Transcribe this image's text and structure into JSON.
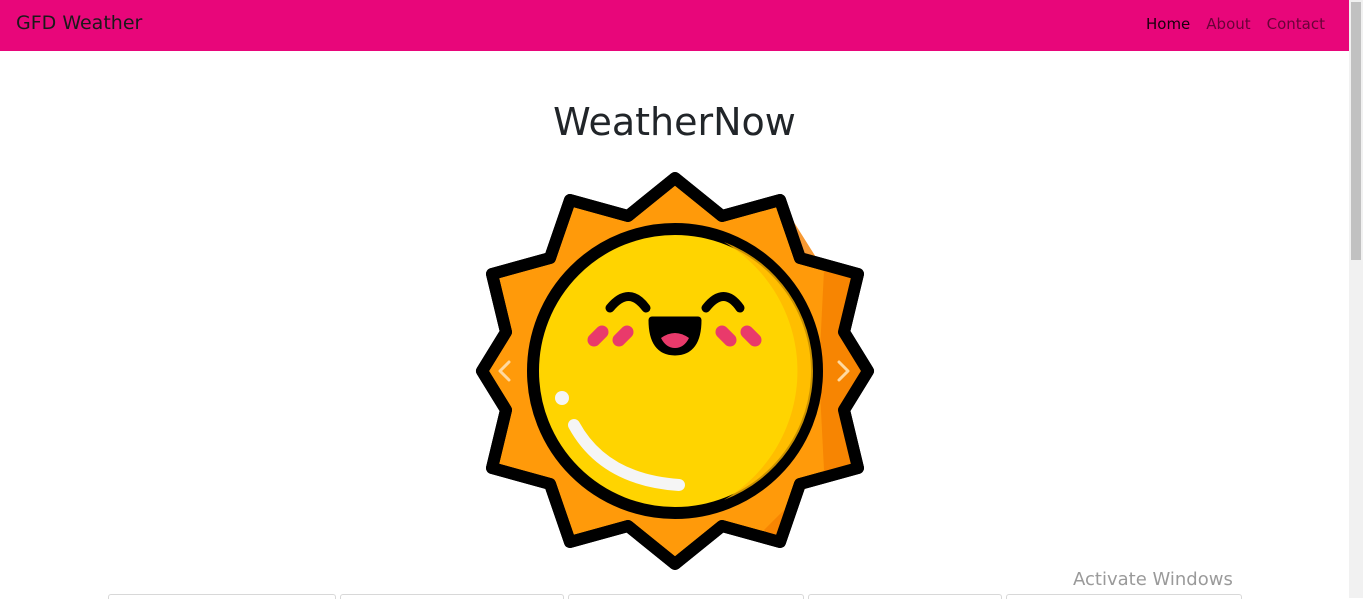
{
  "navbar": {
    "brand": "GFD Weather",
    "links": [
      {
        "label": "Home",
        "active": true
      },
      {
        "label": "About",
        "active": false
      },
      {
        "label": "Contact",
        "active": false
      }
    ],
    "background": "#e8067a"
  },
  "main": {
    "title": "WeatherNow",
    "carousel": {
      "image_icon": "smiling-sun-icon",
      "prev_icon": "chevron-left-icon",
      "next_icon": "chevron-right-icon"
    }
  },
  "watermark": "Activate Windows"
}
